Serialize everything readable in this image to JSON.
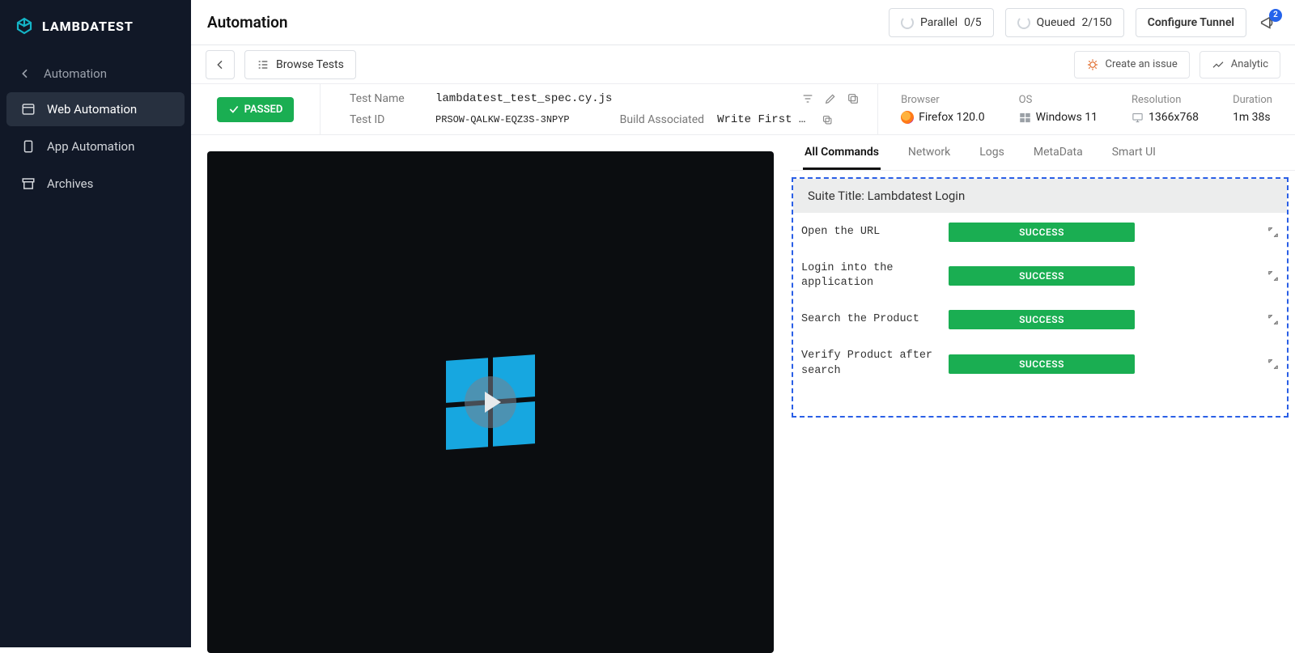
{
  "brand": "LAMBDATEST",
  "page_title": "Automation",
  "top": {
    "parallel_label": "Parallel",
    "parallel_value": "0/5",
    "queued_label": "Queued",
    "queued_value": "2/150",
    "configure_tunnel": "Configure Tunnel",
    "notif_count": "2"
  },
  "subbar": {
    "browse": "Browse Tests",
    "create_issue": "Create an issue",
    "analytics": "Analytic"
  },
  "sidebar": {
    "back_label": "Automation",
    "items": [
      {
        "label": "Web Automation"
      },
      {
        "label": "App Automation"
      },
      {
        "label": "Archives"
      }
    ]
  },
  "status_text": "PASSED",
  "test": {
    "name_label": "Test Name",
    "name_value": "lambdatest_test_spec.cy.js",
    "id_label": "Test ID",
    "id_value": "PRSOW-QALKW-EQZ3S-3NPYP",
    "build_label": "Build Associated",
    "build_value": "Write First …"
  },
  "env": {
    "browser_label": "Browser",
    "browser_value": "Firefox 120.0",
    "os_label": "OS",
    "os_value": "Windows 11",
    "resolution_label": "Resolution",
    "resolution_value": "1366x768",
    "duration_label": "Duration",
    "duration_value": "1m 38s"
  },
  "tabs": [
    "All Commands",
    "Network",
    "Logs",
    "MetaData",
    "Smart UI"
  ],
  "suite": {
    "header": "Suite Title: Lambdatest Login",
    "status_word": "SUCCESS",
    "commands": [
      "Open the URL",
      "Login into the application",
      "Search the Product",
      "Verify Product after search"
    ]
  }
}
